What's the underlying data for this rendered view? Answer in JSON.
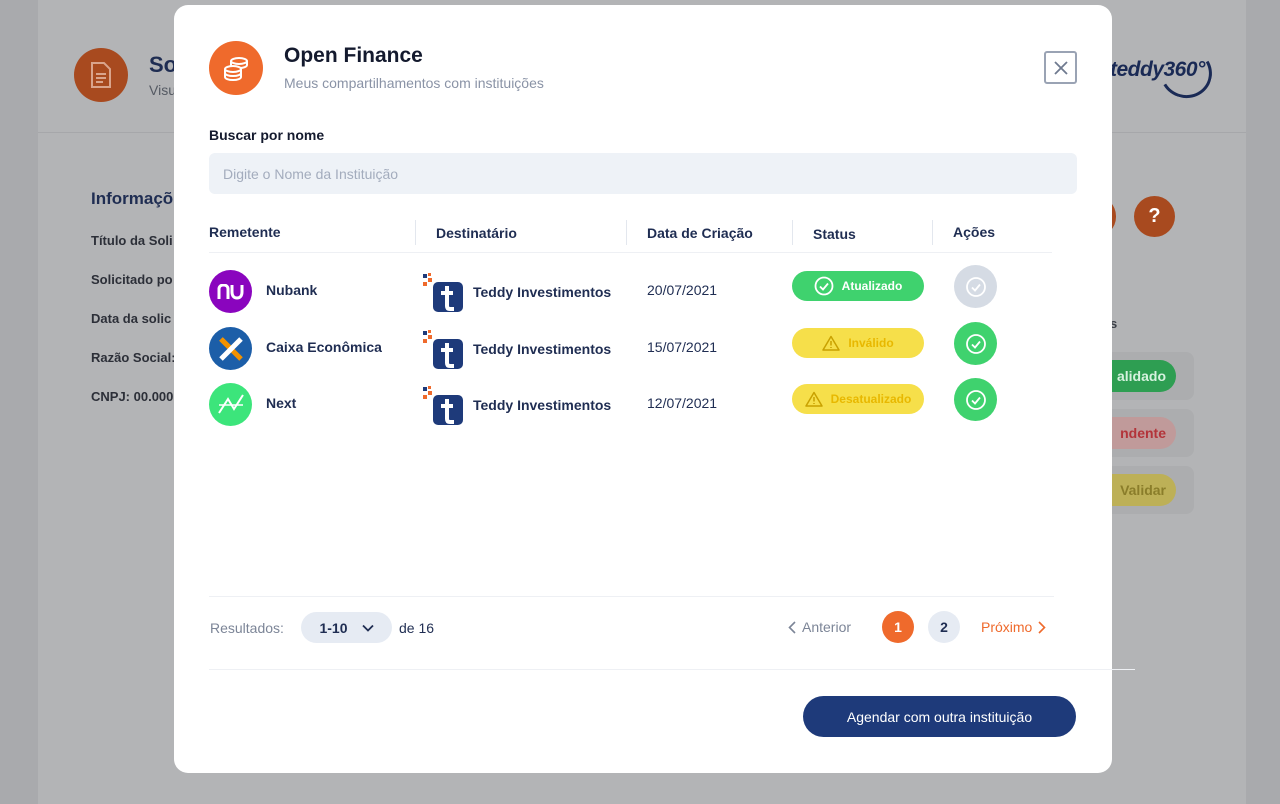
{
  "background": {
    "title": "So",
    "subtitle": "Visu",
    "logo_text": "teddy360°",
    "section_title": "Informaçõ",
    "fields": [
      "Título da Soli",
      "Solicitado po",
      "Data da solic",
      "Razão Social:",
      "CNPJ: 00.000"
    ],
    "help_label": "?",
    "side_label": "s",
    "pills": [
      {
        "label": "alidado",
        "color": "#2e9e52",
        "text": "#d7f2df"
      },
      {
        "label": "ndente",
        "color": "#c08b8b",
        "text": "#b3343a"
      },
      {
        "label": "Validar",
        "color": "#bba94a",
        "text": "#8a7d2a"
      }
    ]
  },
  "modal": {
    "title": "Open Finance",
    "subtitle": "Meus compartilhamentos com instituições",
    "close_icon": "close-icon",
    "search": {
      "label": "Buscar por nome",
      "placeholder": "Digite o Nome da Instituição",
      "value": ""
    },
    "columns": [
      "Remetente",
      "Destinatário",
      "Data de Criação",
      "Status",
      "Ações"
    ],
    "rows": [
      {
        "sender": "Nubank",
        "sender_logo": "nu",
        "sender_color": "#8a05be",
        "recipient": "Teddy Investimentos",
        "date": "20/07/2021",
        "status": "Atualizado",
        "status_type": "success",
        "action_state": "disabled"
      },
      {
        "sender": "Caixa Econômica",
        "sender_logo": "X",
        "sender_color": "#1c5ea8",
        "recipient": "Teddy Investimentos",
        "date": "15/07/2021",
        "status": "Inválido",
        "status_type": "warning",
        "action_state": "enabled"
      },
      {
        "sender": "Next",
        "sender_logo": "next",
        "sender_color": "#00e676",
        "recipient": "Teddy Investimentos",
        "date": "12/07/2021",
        "status": "Desatualizado",
        "status_type": "warning",
        "action_state": "enabled"
      }
    ],
    "pagination": {
      "results_label": "Resultados:",
      "range": "1-10",
      "total_label": "de 16",
      "prev_label": "Anterior",
      "pages": [
        "1",
        "2"
      ],
      "current_page": "1",
      "next_label": "Próximo"
    },
    "cta_label": "Agendar com  outra instituição"
  },
  "colors": {
    "accent": "#ef6a2c",
    "primary": "#1e3a7a",
    "success": "#3fd26e",
    "warning": "#f6df4a"
  }
}
